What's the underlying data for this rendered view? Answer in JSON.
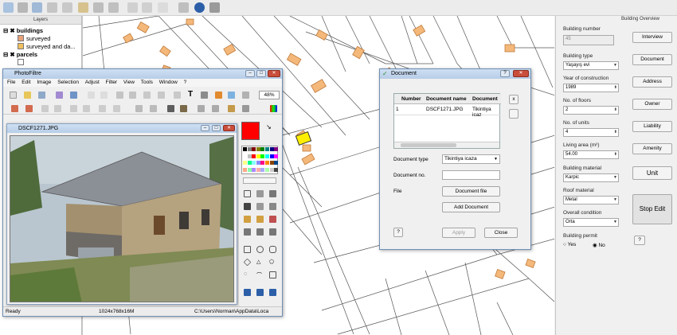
{
  "toolbar": {
    "icons": [
      "hand-icon",
      "select-icon",
      "identify-icon",
      "measure-icon",
      "zoom-icon",
      "toggle-edit-icon",
      "add-feature-icon",
      "node-tool-icon",
      "undo-icon",
      "redo-icon",
      "save-icon",
      "info-icon",
      "options-icon"
    ]
  },
  "layers": {
    "title": "Layers",
    "items": [
      {
        "label": "buildings",
        "bold": true
      },
      {
        "label": "surveyed"
      },
      {
        "label": "surveyed and da..."
      },
      {
        "label": "parcels",
        "bold": true
      }
    ]
  },
  "building_overview": {
    "title": "Building Overview",
    "fields": {
      "building_number": {
        "label": "Building number",
        "value": "45"
      },
      "building_type": {
        "label": "Building type",
        "value": "Yaşayış evi"
      },
      "year_of_construction": {
        "label": "Year of construction",
        "value": "1989"
      },
      "no_of_floors": {
        "label": "No. of floors",
        "value": "2"
      },
      "no_of_units": {
        "label": "No. of units",
        "value": "4"
      },
      "living_area": {
        "label": "Living area (m²)",
        "value": "54.00"
      },
      "building_material": {
        "label": "Building material",
        "value": "Karpic"
      },
      "roof_material": {
        "label": "Roof material",
        "value": "Metal"
      },
      "overall_condition": {
        "label": "Overall condition",
        "value": "Orta"
      },
      "building_permit": {
        "label": "Building permit",
        "yes": "Yes",
        "no": "No"
      }
    },
    "buttons": {
      "interview": "Interview",
      "document": "Document",
      "address": "Address",
      "owner": "Owner",
      "liability": "Liability",
      "amenity": "Amenity",
      "unit": "Unit",
      "stop_edit": "Stop Edit",
      "help": "?"
    }
  },
  "photofiltre": {
    "title": "PhotoFiltre",
    "menu": [
      "File",
      "Edit",
      "Image",
      "Selection",
      "Adjust",
      "Filter",
      "View",
      "Tools",
      "Window",
      "?"
    ],
    "zoom": "48%",
    "image_window_title": "DSCF1271.JPG",
    "status": {
      "left": "Ready",
      "middle": "1024x768x16M",
      "right": "C:\\Users\\Norman\\AppData\\Loca"
    }
  },
  "document_dialog": {
    "title": "Document",
    "table": {
      "headers": [
        "Number",
        "Document name",
        "Document"
      ],
      "rows": [
        [
          "1",
          "",
          "DSCF1271.JPG",
          "Tikintiya icaz"
        ]
      ]
    },
    "x_button": "x",
    "fields": {
      "document_type": {
        "label": "Document type",
        "value": "Tikintiya icaza"
      },
      "document_no": {
        "label": "Document no.",
        "value": ""
      },
      "file": {
        "label": "File"
      }
    },
    "buttons": {
      "document_file": "Document file",
      "add_document": "Add Document",
      "help": "?",
      "apply": "Apply",
      "close": "Close"
    }
  },
  "colors": {
    "selected_building": "#ffee00",
    "building_fill": "#f4b87a",
    "building_stroke": "#c07a3a",
    "swatch_red": "#ff0000"
  }
}
